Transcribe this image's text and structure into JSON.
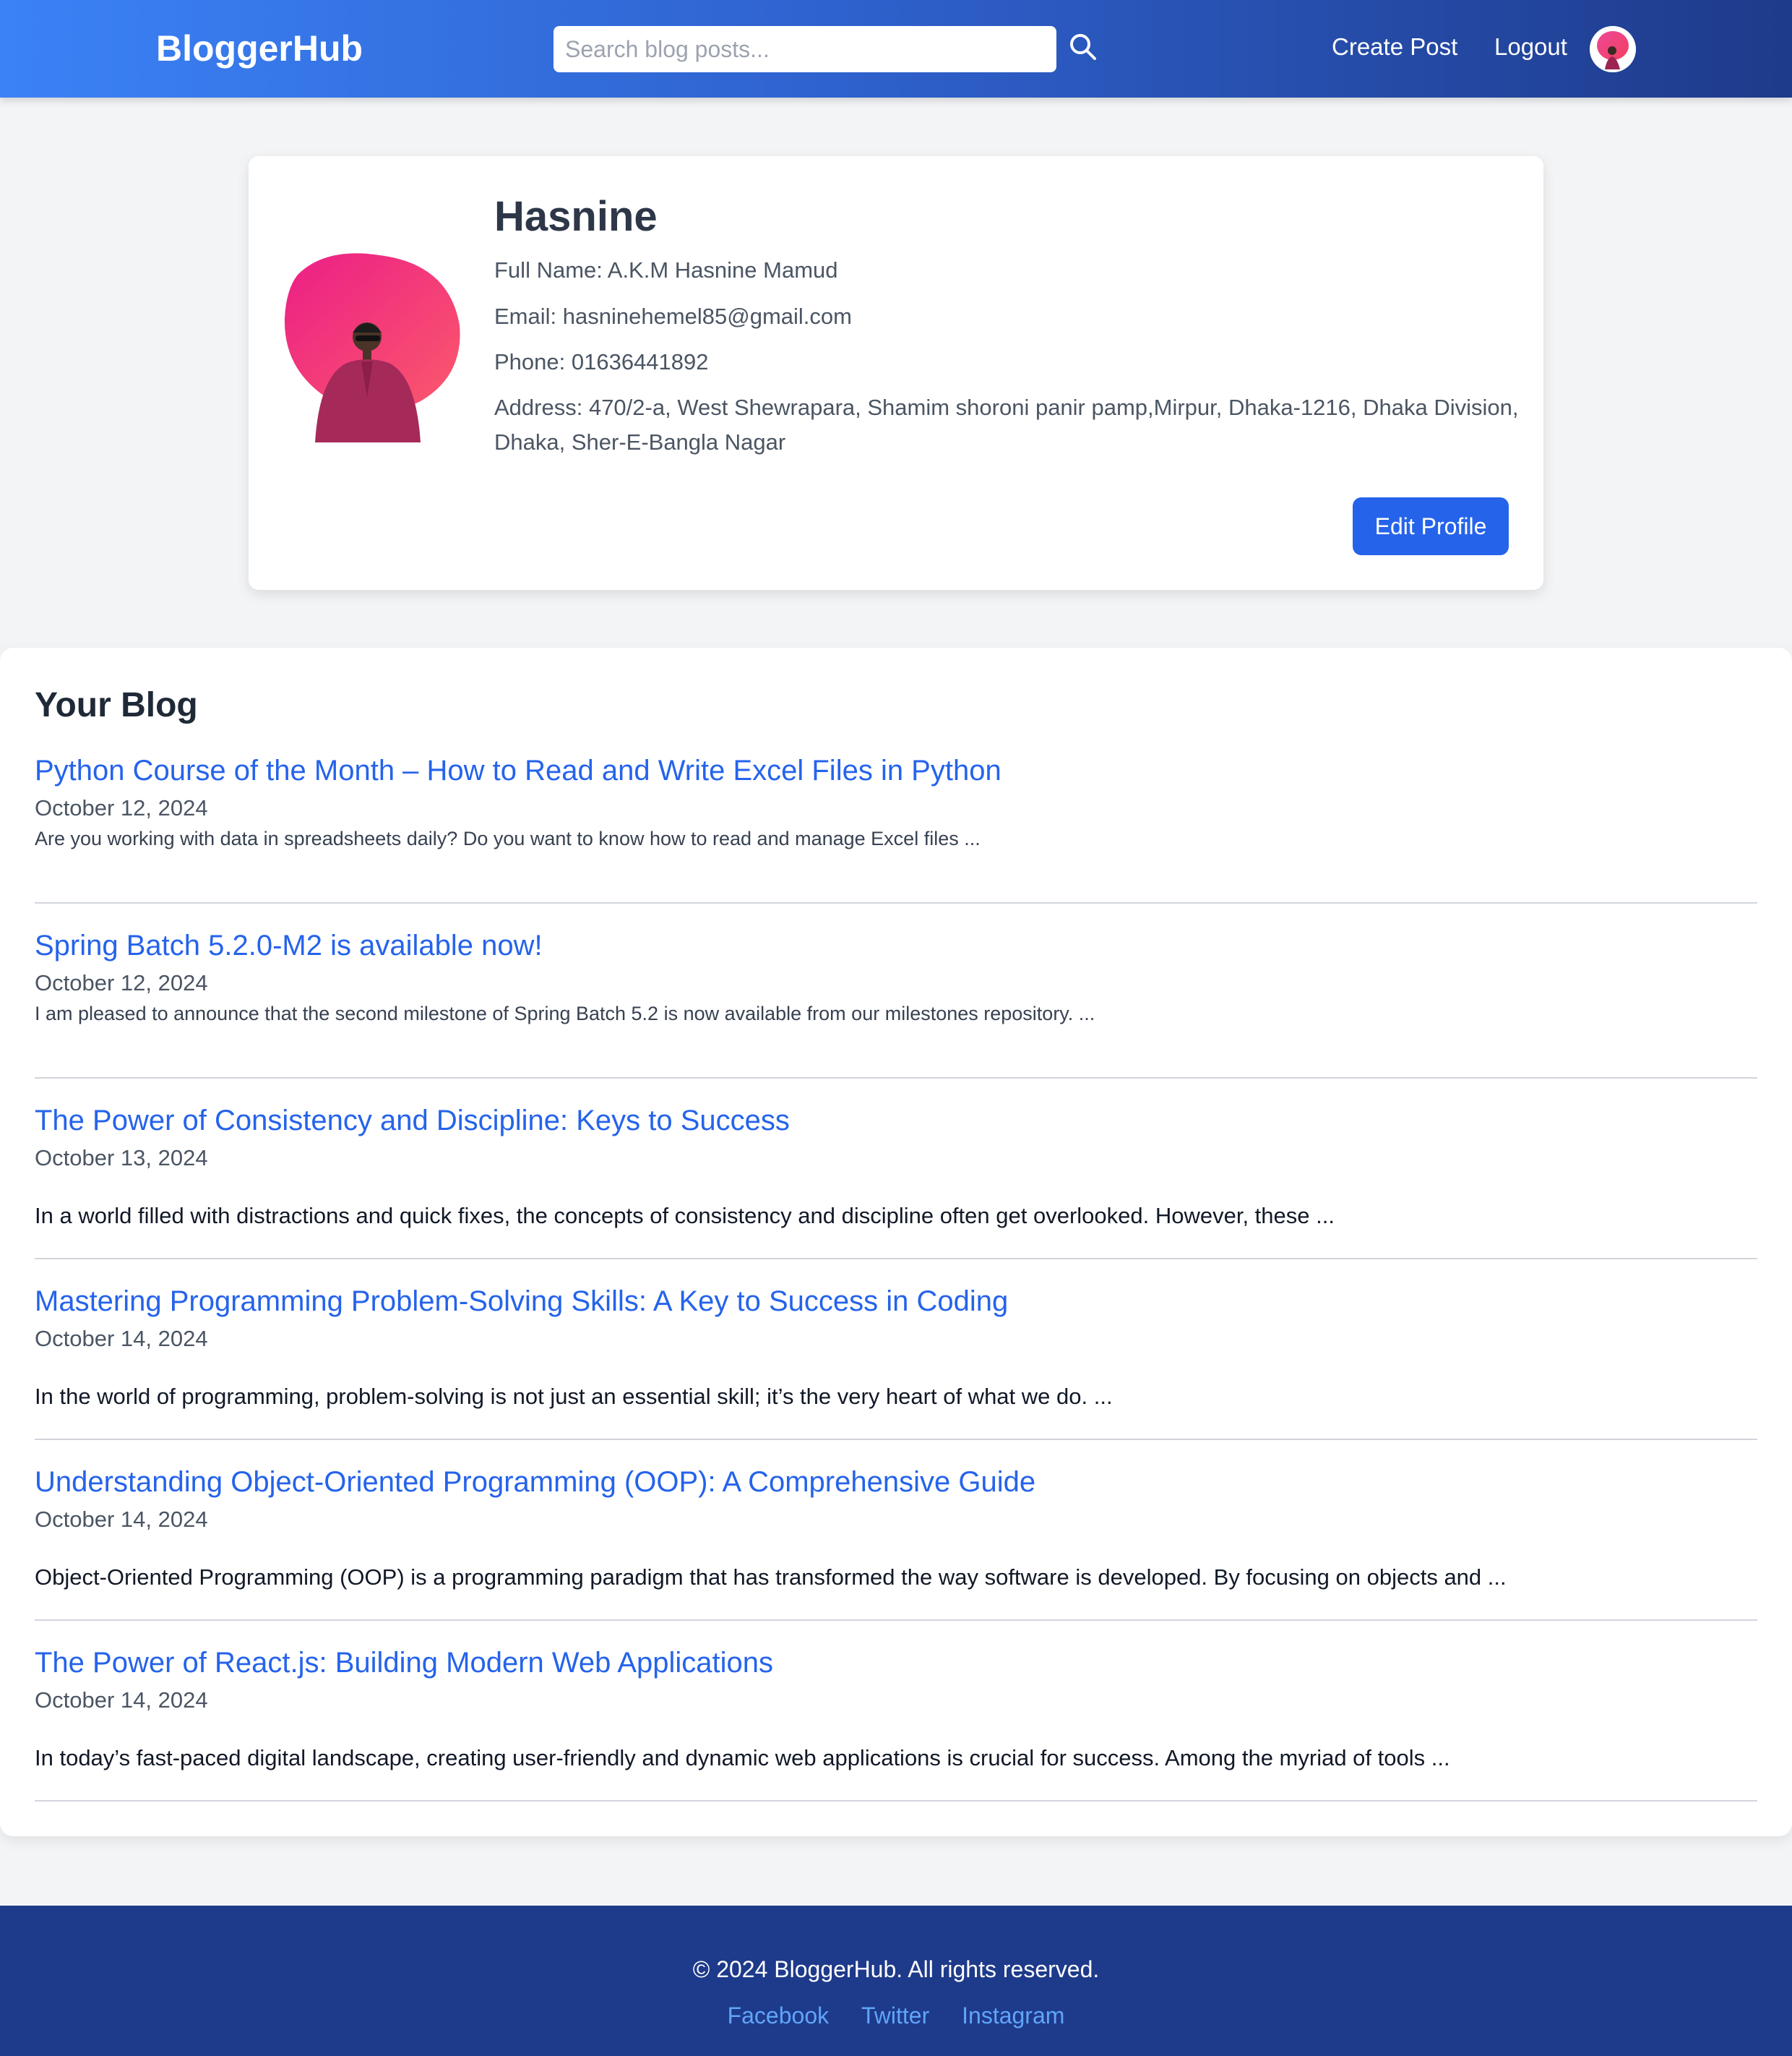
{
  "header": {
    "brand": "BloggerHub",
    "search_placeholder": "Search blog posts...",
    "search_value": "",
    "search_icon": "search-icon",
    "create_post": "Create Post",
    "logout": "Logout"
  },
  "profile": {
    "username": "Hasnine",
    "full_name": "Full Name: A.K.M Hasnine Mamud",
    "email": "Email: hasninehemel85@gmail.com",
    "phone": "Phone: 01636441892",
    "address": "Address: 470/2-a, West Shewrapara, Shamim shoroni panir pamp,Mirpur, Dhaka-1216, Dhaka Division, Dhaka, Sher-E-Bangla Nagar",
    "edit_button": "Edit Profile"
  },
  "blog": {
    "heading": "Your Blog",
    "posts": [
      {
        "title": "Python Course of the Month – How to Read and Write Excel Files in Python",
        "date": "October 12, 2024",
        "excerpt": "Are you working with data in spreadsheets daily? Do you want to know how to read and manage Excel files ..."
      },
      {
        "title": "Spring Batch 5.2.0-M2 is available now!",
        "date": "October 12, 2024",
        "excerpt": "I am pleased to announce that the second milestone of Spring Batch 5.2 is now available from our milestones repository. ..."
      },
      {
        "title": "The Power of Consistency and Discipline: Keys to Success",
        "date": "October 13, 2024",
        "excerpt": "In a world filled with distractions and quick fixes, the concepts of consistency and discipline often get overlooked. However, these ..."
      },
      {
        "title": "Mastering Programming Problem-Solving Skills: A Key to Success in Coding",
        "date": "October 14, 2024",
        "excerpt": "In the world of programming, problem-solving is not just an essential skill; it’s the very heart of what we do. ..."
      },
      {
        "title": "Understanding Object-Oriented Programming (OOP): A Comprehensive Guide",
        "date": "October 14, 2024",
        "excerpt": "Object-Oriented Programming (OOP) is a programming paradigm that has transformed the way software is developed. By focusing on objects and ..."
      },
      {
        "title": "The Power of React.js: Building Modern Web Applications",
        "date": "October 14, 2024",
        "excerpt": "In today’s fast-paced digital landscape, creating user-friendly and dynamic web applications is crucial for success. Among the myriad of tools ..."
      }
    ]
  },
  "footer": {
    "copyright": "© 2024 BloggerHub. All rights reserved.",
    "links": [
      "Facebook",
      "Twitter",
      "Instagram"
    ]
  },
  "colors": {
    "nav_gradient_start": "#3b82f6",
    "nav_gradient_end": "#1e3a8a",
    "accent": "#2563eb",
    "footer_bg": "#1e3a8a",
    "footer_link": "#60a5fa",
    "avatar_blob_start": "#ec4899",
    "avatar_blob_end": "#f43f5e"
  }
}
